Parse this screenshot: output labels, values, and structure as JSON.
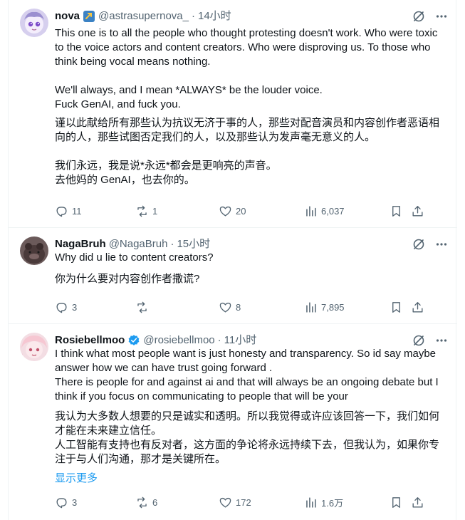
{
  "posts": [
    {
      "display_name": "nova",
      "badge": "blue-square-badge-icon",
      "handle": "@astrasupernova_",
      "time": "14小时",
      "original_paragraphs": [
        "This one is to all the people who thought protesting doesn't work. Who were toxic to the voice actors and content creators. Who were disproving us. To those who think being vocal means nothing.",
        "We'll always, and I mean *ALWAYS* be the louder voice.\nFuck GenAI, and fuck you."
      ],
      "translated_paragraphs": [
        "谨以此献给所有那些认为抗议无济于事的人，那些对配音演员和内容创作者恶语相向的人，那些试图否定我们的人，以及那些认为发声毫无意义的人。",
        "我们永远，我是说*永远*都会是更响亮的声音。\n去他妈的 GenAI，也去你的。"
      ],
      "stats": {
        "replies": "11",
        "reposts": "1",
        "likes": "20",
        "views": "6,037"
      }
    },
    {
      "display_name": "NagaBruh",
      "handle": "@NagaBruh",
      "time": "15小时",
      "original_paragraphs": [
        "Why did u lie to content creators?"
      ],
      "translated_paragraphs": [
        "你为什么要对内容创作者撒谎?"
      ],
      "stats": {
        "replies": "3",
        "reposts": "",
        "likes": "8",
        "views": "7,895"
      }
    },
    {
      "display_name": "Rosiebellmoo",
      "badge": "verified-badge-icon",
      "handle": "@rosiebellmoo",
      "time": "11小时",
      "original_paragraphs": [
        "I think what most people want is just honesty and transparency. So id say maybe answer how we can have trust going forward .\nThere is people for and against ai and that will always be an ongoing debate but I think if you focus on communicating to people that will be your"
      ],
      "translated_paragraphs": [
        "我认为大多数人想要的只是诚实和透明。所以我觉得或许应该回答一下，我们如何才能在未来建立信任。\n人工智能有支持也有反对者，这方面的争论将永远持续下去，但我认为，如果你专注于与人们沟通，那才是关键所在。"
      ],
      "show_more": "显示更多",
      "stats": {
        "replies": "3",
        "reposts": "6",
        "likes": "172",
        "views": "1.6万"
      }
    }
  ],
  "colors": {
    "text": "#0f1419",
    "muted": "#536471",
    "link": "#1d9bf0",
    "border": "#eff3f4",
    "verified": "#1d9bf0",
    "badge_square": "#3b82c4"
  }
}
